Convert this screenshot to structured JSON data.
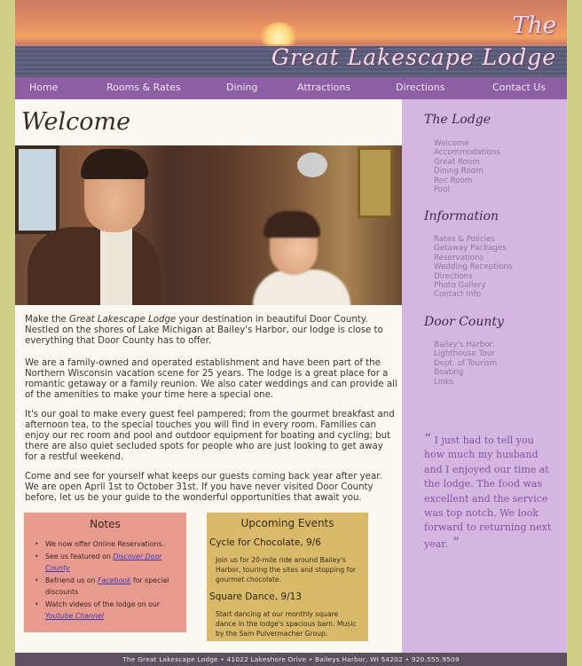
{
  "header": {
    "title_the": "The",
    "title_main": "Great Lakescape Lodge"
  },
  "nav": {
    "items": [
      {
        "label": "Home"
      },
      {
        "label": "Rooms & Rates"
      },
      {
        "label": "Dining"
      },
      {
        "label": "Attractions"
      },
      {
        "label": "Directions"
      },
      {
        "label": "Contact Us"
      }
    ]
  },
  "main": {
    "heading": "Welcome",
    "p1_a": "Make the ",
    "p1_b": "Great Lakescape Lodge",
    "p1_c": " your destination in beautiful Door County. Nestled on the shores of Lake Michigan at Bailey's Harbor, our lodge is close to everything that Door County has to offer.",
    "p2": "We are a family-owned and operated establishment and have been part of the Northern Wisconsin vacation scene for 25 years. The lodge is a great place for a romantic getaway or a family reunion. We also cater weddings and can provide all of the amenities to make your time here a special one.",
    "p3": "It's our goal to make every guest feel pampered; from the gourmet breakfast and afternoon tea, to the special touches you will find in every room. Families can enjoy our rec room and pool and outdoor equipment for boating and cycling; but there are also quiet secluded spots for people who are just looking to get away for a restful weekend.",
    "p4": "Come and see for yourself what keeps our guests coming back year after year. We are open April 1st to October 31st. If you have never visited Door County before, let us be your guide to the wonderful opportunities that await you."
  },
  "notes": {
    "title": "Notes",
    "item1": "We now offer Online Reservations.",
    "item2_pre": "See us featured on ",
    "item2_link": "Discover Door County",
    "item3_pre": "Befriend us on ",
    "item3_link": "Facebook",
    "item3_post": " for special discounts",
    "item4_pre": "Watch videos of the lodge on our ",
    "item4_link": "Youtube Channel"
  },
  "events": {
    "title": "Upcoming Events",
    "list": [
      {
        "name": "Cycle for Chocolate, 9/6",
        "desc": "Join us for 20-mile ride around Bailey's Harbor, touring the sites and stopping for gourmet chocolate."
      },
      {
        "name": "Square Dance, 9/13",
        "desc": "Start dancing at our monthly square dance in the lodge's spacious barn. Music by the Sam Pulvermacher Group."
      }
    ]
  },
  "sidebar": {
    "lodge_heading": "The Lodge",
    "lodge_links": [
      "Welcome",
      "Accommodations",
      "Great Room",
      "Dining Room",
      "Rec Room",
      "Pool"
    ],
    "info_heading": "Information",
    "info_links": [
      "Rates & Policies",
      "Getaway Packages",
      "Reservations",
      "Wedding Receptions",
      "Directions",
      "Photo Gallery",
      "Contact Info"
    ],
    "county_heading": "Door County",
    "county_links": [
      "Bailey's Harbor",
      "Lighthouse Tour",
      "Dept. of Tourism",
      "Boating",
      "Links"
    ],
    "quote_open": "“",
    "quote_text": " I just had to tell you how much my husband and I enjoyed our time at the lodge. The food was excellent and the service was top notch. We look forward to returning next year.",
    "quote_close": " ”"
  },
  "footer": {
    "text": "The Great Lakescape Lodge • 41022 Lakeshore Drive • Baileys Harbor, WI 54202 • 920.555.9509"
  },
  "colors": {
    "nav_bg": "#8c5fa3",
    "sidebar_bg": "#d5b6e0",
    "notes_bg": "#e79a8e",
    "events_bg": "#d9b96a",
    "footer_bg": "#5d5160"
  }
}
